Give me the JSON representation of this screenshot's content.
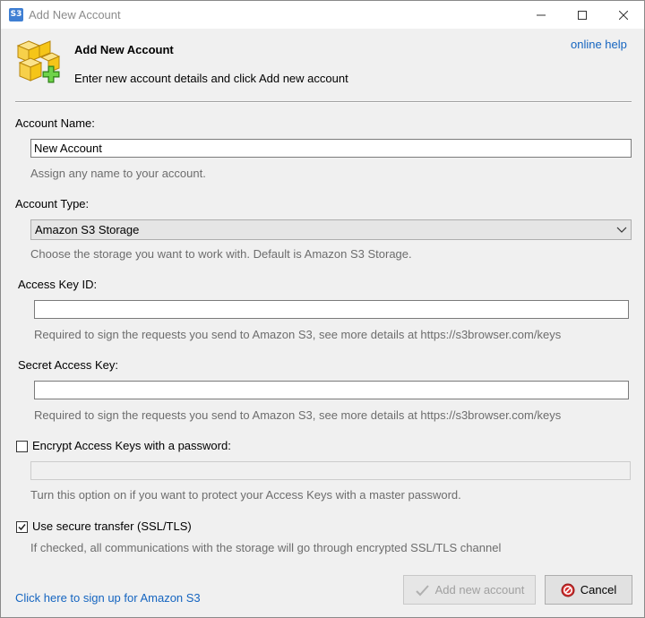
{
  "window": {
    "title": "Add New Account",
    "app_icon_text": "S3"
  },
  "header": {
    "title": "Add New Account",
    "subtitle": "Enter new account details and click Add new account",
    "help_link": "online help"
  },
  "form": {
    "account_name": {
      "label": "Account Name:",
      "value": "New Account",
      "hint": "Assign any name to your account."
    },
    "account_type": {
      "label": "Account Type:",
      "selected": "Amazon S3 Storage",
      "hint": "Choose the storage you want to work with. Default is Amazon S3 Storage."
    },
    "access_key_id": {
      "label": "Access Key ID:",
      "value": "",
      "hint": "Required to sign the requests you send to Amazon S3, see more details at https://s3browser.com/keys"
    },
    "secret_access_key": {
      "label": "Secret Access Key:",
      "value": "",
      "hint": "Required to sign the requests you send to Amazon S3, see more details at https://s3browser.com/keys"
    },
    "encrypt": {
      "label": "Encrypt Access Keys with a password:",
      "checked": false,
      "password_value": "",
      "hint": "Turn this option on if you want to protect your Access Keys with a master password."
    },
    "secure_transfer": {
      "label": "Use secure transfer (SSL/TLS)",
      "checked": true,
      "hint": "If checked, all communications with the storage will go through encrypted SSL/TLS channel"
    }
  },
  "footer": {
    "signup_link": "Click here to sign up for Amazon S3",
    "add_button": "Add new account",
    "cancel_button": "Cancel"
  },
  "colors": {
    "link": "#1565c0",
    "hint_text": "#6d6d6d",
    "accent_green": "#4caf2a",
    "box_yellow": "#f5c518",
    "cancel_red": "#d32f2f"
  }
}
